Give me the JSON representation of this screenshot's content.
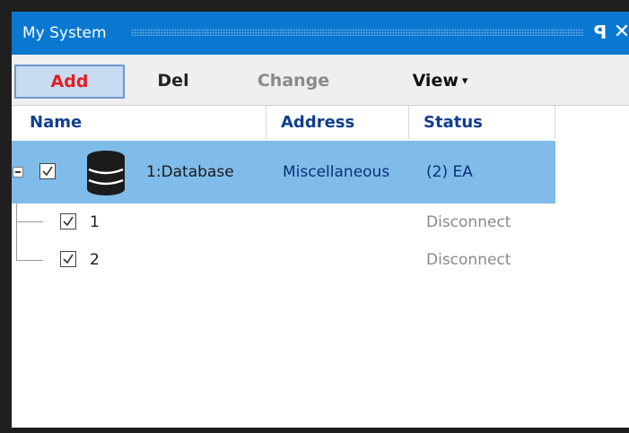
{
  "window": {
    "title": "My System",
    "pin_glyph": "ꟼ",
    "close_glyph": "✕"
  },
  "toolbar": {
    "add_label": "Add",
    "del_label": "Del",
    "change_label": "Change",
    "view_label": "View",
    "view_caret": "▾"
  },
  "columns": {
    "name": "Name",
    "address": "Address",
    "status": "Status"
  },
  "tree": {
    "root": {
      "name": "1:Database",
      "address": "Miscellaneous",
      "status": "(2) EA",
      "checked": true,
      "expanded": true,
      "icon": "database-icon"
    },
    "children": [
      {
        "name": "1",
        "address": "",
        "status": "Disconnect",
        "checked": true
      },
      {
        "name": "2",
        "address": "",
        "status": "Disconnect",
        "checked": true
      }
    ]
  },
  "colors": {
    "titlebar": "#0a78d1",
    "selected_row": "#7fbce9",
    "add_text": "#e02020",
    "header_text": "#103f8e"
  }
}
